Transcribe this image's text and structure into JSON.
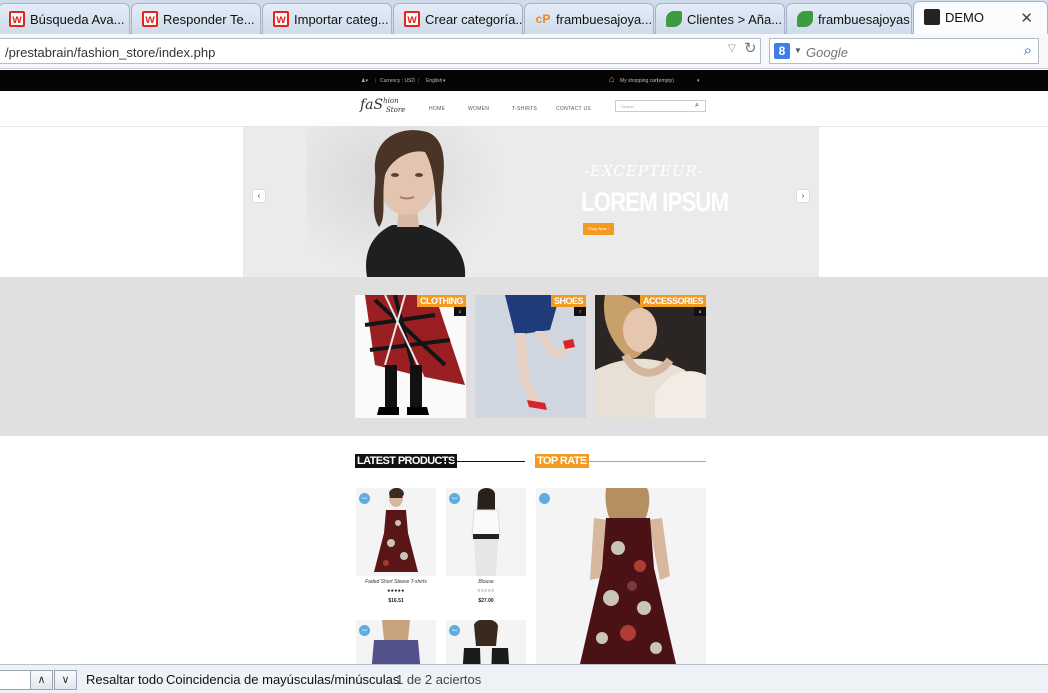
{
  "tabs": [
    {
      "title": "Búsqueda Ava...",
      "icon": "wishpond-icon"
    },
    {
      "title": "Responder Te...",
      "icon": "wishpond-icon"
    },
    {
      "title": "Importar categ...",
      "icon": "wishpond-icon"
    },
    {
      "title": "Crear categoría...",
      "icon": "wishpond-icon"
    },
    {
      "title": "frambuesajoya...",
      "icon": "cpanel-icon"
    },
    {
      "title": "Clientes > Aña...",
      "icon": "leaf-icon"
    },
    {
      "title": "frambuesajoyas",
      "icon": "leaf-icon"
    },
    {
      "title": "DEMO",
      "icon": "shopping-bag-icon",
      "active": true
    }
  ],
  "tab_close": "✕",
  "address": {
    "url": "/prestabrain/fashion_store/index.php"
  },
  "search": {
    "placeholder": "Google",
    "engine_letter": "8"
  },
  "site": {
    "top": {
      "currency": "Currency : USD",
      "language": "English",
      "cart": "My shopping cart",
      "cart_state": "(empty)"
    },
    "logo_main": "faS",
    "logo_sup": "hion",
    "logo_sub": "Store",
    "nav": [
      "HOME",
      "WOMEN",
      "T-SHIRTS",
      "CONTACT US"
    ],
    "search_placeholder": "Search",
    "banner": {
      "subtitle": "-EXCEPTEUR-",
      "title": "LOREM IPSUM",
      "button": "Shop Now ›",
      "prev": "‹",
      "next": "›"
    },
    "categories": [
      {
        "label": "CLOTHING",
        "count": "2"
      },
      {
        "label": "SHOES",
        "count": "7"
      },
      {
        "label": "ACCESSORIES",
        "count": "8"
      }
    ],
    "sections": {
      "latest": "LATEST PRODUCTS",
      "top_rate": "TOP RATE"
    },
    "products": [
      {
        "name": "Faded Short Sleeve T-shirts",
        "stars": "●●●●●",
        "price": "$16.51",
        "badge": "new"
      },
      {
        "name": "Blouse",
        "stars": "○○○○○",
        "price": "$27.00",
        "badge": "new"
      },
      {
        "badge": "new"
      },
      {
        "badge": "new"
      }
    ]
  },
  "findbar": {
    "highlight_all": "Resaltar todo",
    "match_case": "Coincidencia de mayúsculas/minúsculas",
    "status": "1 de 2 aciertos",
    "prev": "∧",
    "next": "∨"
  },
  "colors": {
    "accent": "#f39a21",
    "tab_bar": "#cfdcec",
    "page_band": "#e0e0e0"
  }
}
